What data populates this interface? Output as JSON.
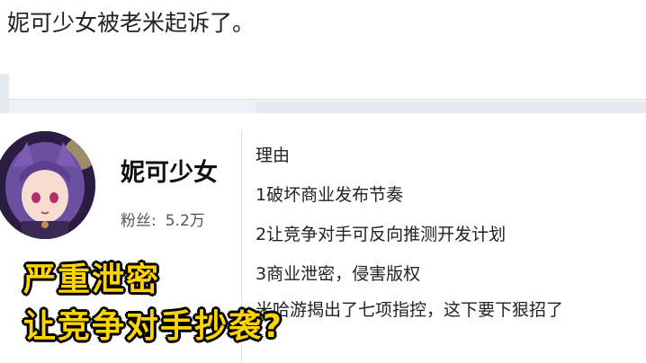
{
  "post": {
    "headline": "妮可少女被老米起诉了。"
  },
  "profile": {
    "name": "妮可少女",
    "followers_label": "粉丝:",
    "followers_value": "5.2万"
  },
  "reasons": {
    "title": "理由",
    "items": [
      "1破坏商业发布节奏",
      "2让竞争对手可反向推测开发计划",
      "3商业泄密，侵害版权",
      "米哈游揭出了七项指控，这下要下狠招了"
    ]
  },
  "caption": {
    "line1": "严重泄密",
    "line2": "让竞争对手抄袭?"
  },
  "colors": {
    "caption": "#ffd400",
    "caption_outline": "#000000",
    "band": "#eef2f7"
  }
}
